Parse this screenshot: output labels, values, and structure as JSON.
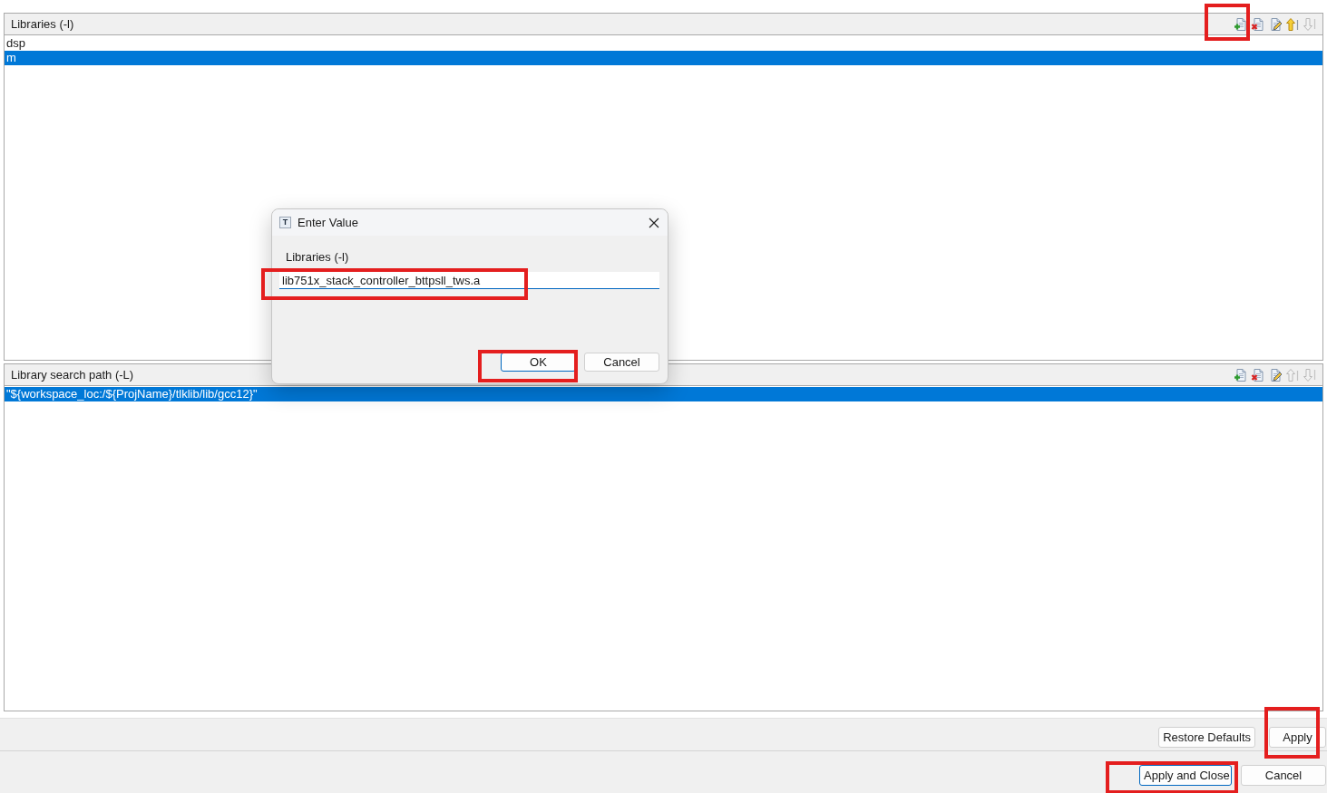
{
  "panels": [
    {
      "title": "Libraries (-l)",
      "toolbar": [
        {
          "kind": "add",
          "disabled": false,
          "highlighted": true
        },
        {
          "kind": "delete",
          "disabled": false,
          "highlighted": false
        },
        {
          "kind": "edit",
          "disabled": false,
          "highlighted": false
        },
        {
          "kind": "move_up",
          "disabled": false,
          "highlighted": false
        },
        {
          "kind": "move_down",
          "disabled": true,
          "highlighted": false
        }
      ],
      "items": [
        {
          "text": "dsp",
          "selected": false
        },
        {
          "text": "m",
          "selected": true
        }
      ]
    },
    {
      "title": "Library search path (-L)",
      "toolbar": [
        {
          "kind": "add",
          "disabled": false,
          "highlighted": false
        },
        {
          "kind": "delete",
          "disabled": false,
          "highlighted": false
        },
        {
          "kind": "edit",
          "disabled": false,
          "highlighted": false
        },
        {
          "kind": "move_up",
          "disabled": true,
          "highlighted": false
        },
        {
          "kind": "move_down",
          "disabled": true,
          "highlighted": false
        }
      ],
      "items": [
        {
          "text": "\"${workspace_loc:/${ProjName}/tlklib/lib/gcc12}\"",
          "selected": true
        }
      ]
    }
  ],
  "dialog": {
    "title_icon": "T",
    "title": "Enter Value",
    "label": "Libraries (-l)",
    "input": {
      "value": "lib751x_stack_controller_bttpsll_tws.a",
      "highlighted": true
    },
    "buttons": [
      {
        "label": "OK",
        "default": true,
        "highlighted": true
      },
      {
        "label": "Cancel",
        "default": false,
        "highlighted": false
      }
    ]
  },
  "page_buttons": [
    {
      "label": "Restore Defaults",
      "default": false,
      "highlighted": false
    },
    {
      "label": "Apply",
      "default": false,
      "highlighted": true
    }
  ],
  "footer_buttons": [
    {
      "label": "Apply and Close",
      "default": true,
      "highlighted": true
    },
    {
      "label": "Cancel",
      "default": false,
      "highlighted": false
    }
  ]
}
